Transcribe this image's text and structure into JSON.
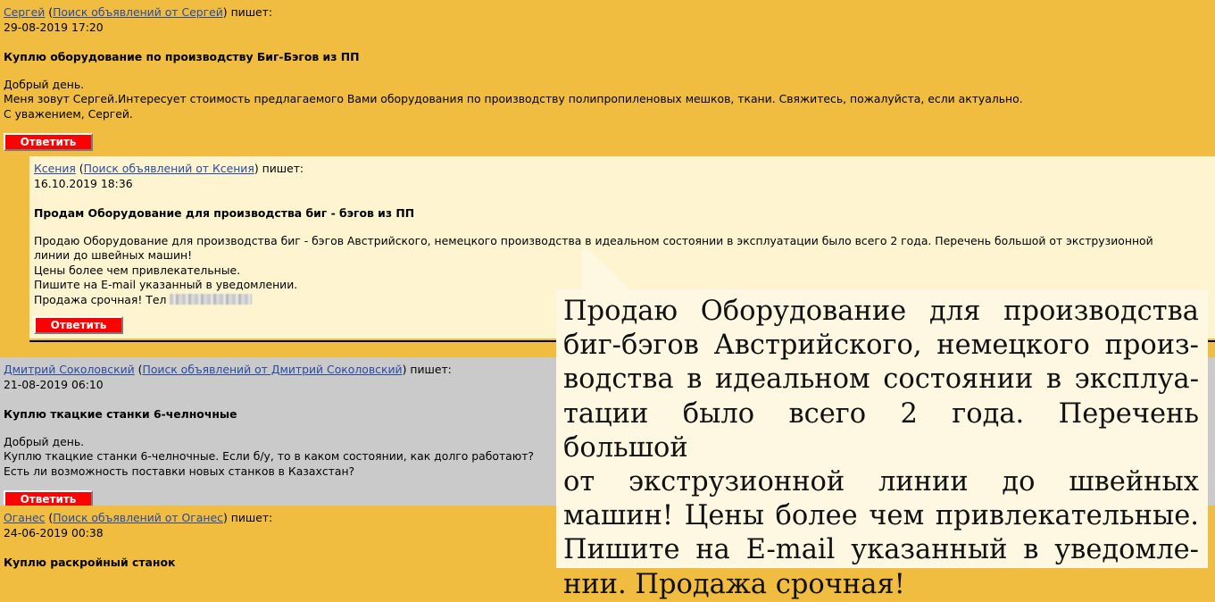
{
  "posts": [
    {
      "author": "Сергей",
      "search_link": "Поиск объявлений от Сергей",
      "writes": "пишет:",
      "date": "29-08-2019 17:20",
      "subject": "Куплю оборудование по производству Биг-Бэгов из ПП",
      "body": [
        "Добрый день.",
        "Меня зовут Сергей.Интересует стоимость предлагаемого Вами оборудования по производству полипропиленовых мешков, ткани. Свяжитесь, пожалуйста, если актуально.",
        "С уважением, Сергей."
      ],
      "reply_label": "Ответить"
    },
    {
      "author": "Ксения",
      "search_link": "Поиск объявлений от Ксения",
      "writes": "пишет:",
      "date": "16.10.2019 18:36",
      "subject": "Продам Оборудование для производства биг - бэгов из ПП",
      "body": [
        "Продаю Оборудование для производства биг - бэгов Австрийского, немецкого производства в идеальном состоянии в эксплуатации было всего 2 года. Перечень большой от экструзионной",
        "линии до швейных машин!",
        "Цены более чем привлекательные.",
        "Пишите на E-mail указанный в уведомлении.",
        "Продажа срочная! Тел"
      ],
      "reply_label": "Ответить"
    },
    {
      "author": "Дмитрий Соколовский",
      "search_link": "Поиск объявлений от Дмитрий Соколовский",
      "writes": "пишет:",
      "date": "21-08-2019 06:10",
      "subject": "Куплю ткацкие станки 6-челночные",
      "body": [
        "Добрый день.",
        "Куплю ткацкие станки 6-челночные. Если б/у, то в каком состоянии, как долго работают?",
        "Есть ли возможность поставки новых станков в Казахстан?"
      ],
      "reply_label": "Ответить"
    },
    {
      "author": "Оганес",
      "search_link": "Поиск объявлений от Оганес",
      "writes": "пишет:",
      "date": "24-06-2019 00:38",
      "subject": "Куплю раскройный станок"
    }
  ],
  "callout": {
    "lines": [
      "Продаю Оборудование для производства",
      "биг-бэгов Австрийского, немецкого произ-",
      "водства в идеальном состоянии в эксплуа-",
      "тации было всего 2 года. Перечень большой",
      "от экструзионной линии до швейных",
      "машин! Цены более чем привлекательные.",
      "Пишите на E-mail указанный в уведомле-",
      "нии. Продажа срочная!"
    ]
  },
  "colors": {
    "orange_bg": "#f0bd40",
    "reply_bg": "#fef4cf",
    "gray_bg": "#cacaca",
    "button_red": "#ff0000",
    "link": "#2a4aa0"
  }
}
